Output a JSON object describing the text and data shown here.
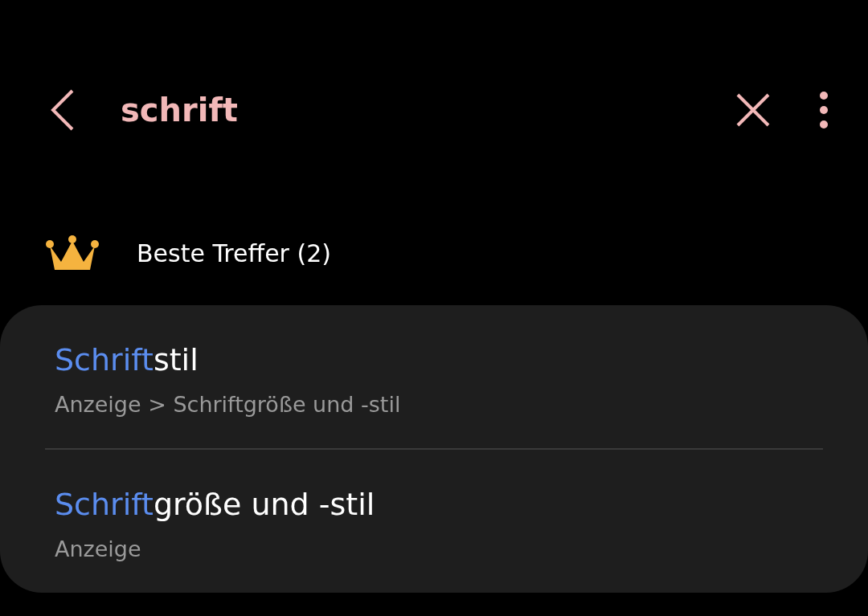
{
  "search": {
    "value": "schrift"
  },
  "section": {
    "title": "Beste Treffer (2)"
  },
  "results": [
    {
      "title_match": "Schrift",
      "title_rest": "stil",
      "path": "Anzeige > Schriftgröße und -stil"
    },
    {
      "title_match": "Schrift",
      "title_rest": "größe und -stil",
      "path": "Anzeige"
    }
  ]
}
